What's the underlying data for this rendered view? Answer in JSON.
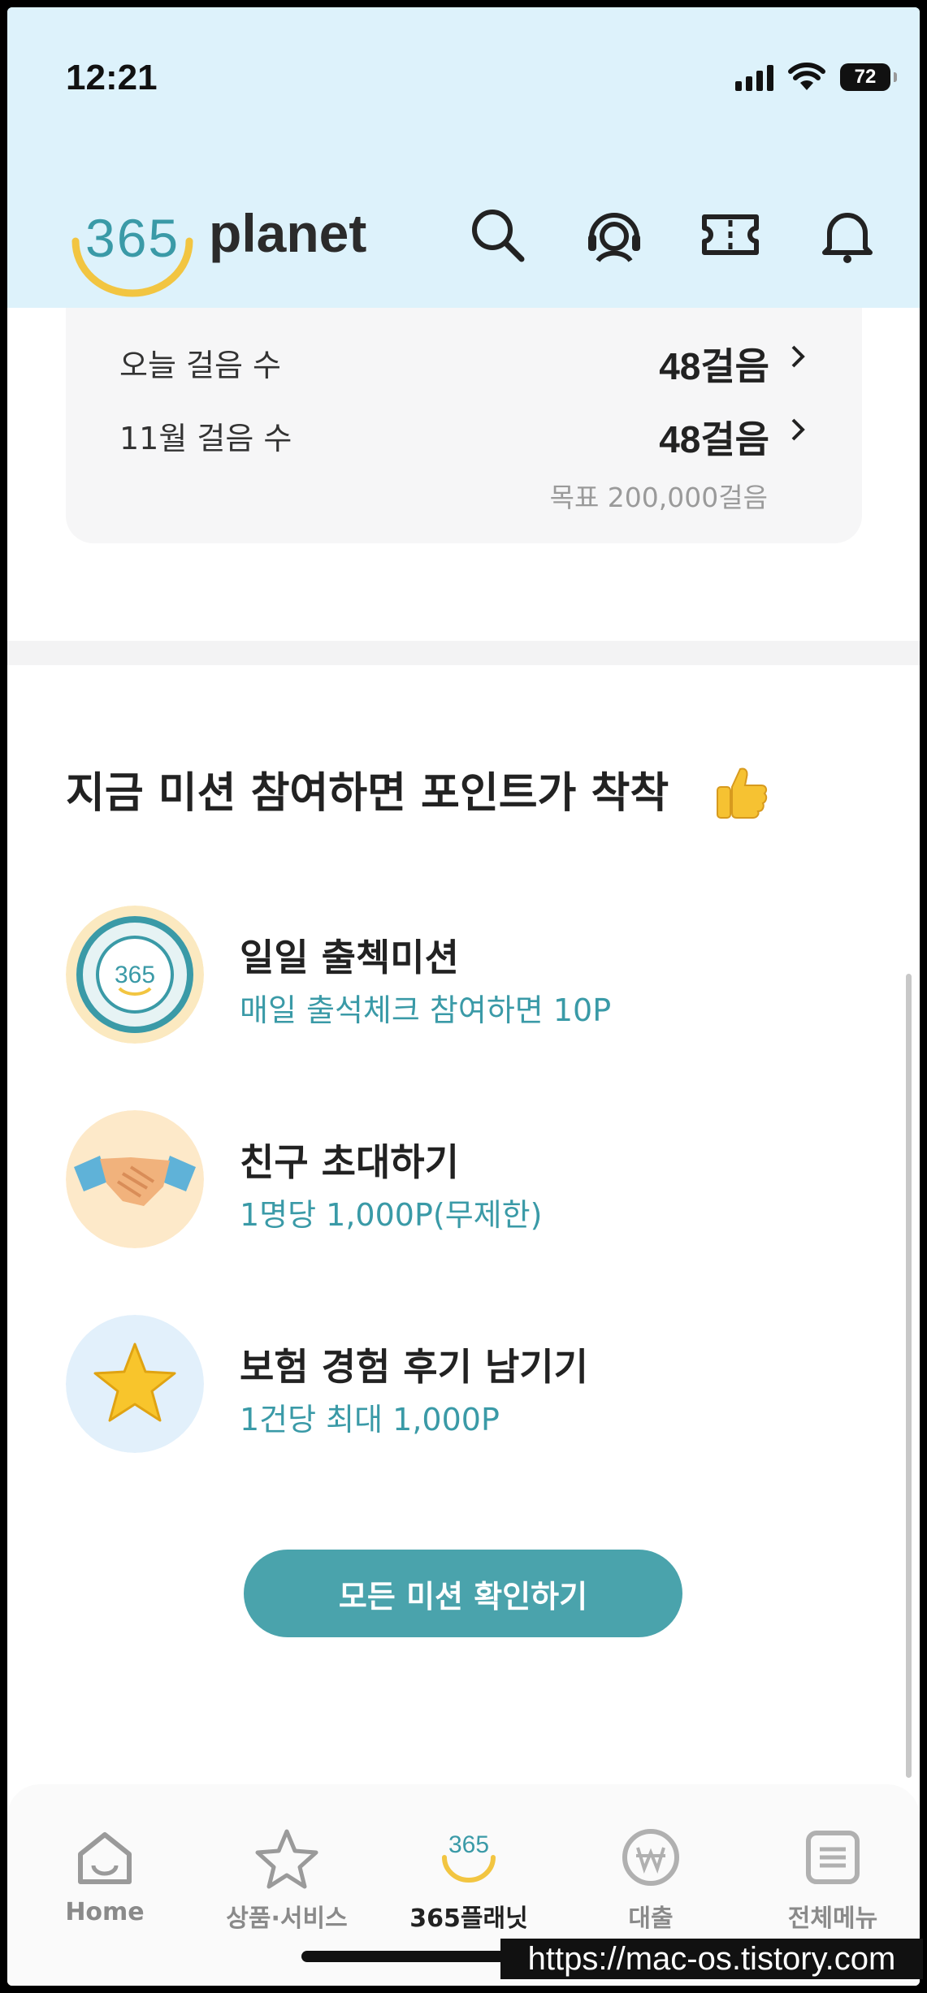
{
  "status": {
    "time": "12:21",
    "battery": "72"
  },
  "header": {
    "logo_number": "365",
    "logo_text": "planet",
    "icons": [
      "search-icon",
      "headset-icon",
      "ticket-icon",
      "bell-icon"
    ]
  },
  "steps": {
    "rows": [
      {
        "label": "오늘 걸음 수",
        "value": "48걸음"
      },
      {
        "label": "11월 걸음 수",
        "value": "48걸음"
      }
    ],
    "goal": "목표 200,000걸음"
  },
  "missions": {
    "title": "지금 미션 참여하면 포인트가 착착",
    "items": [
      {
        "name": "일일 출첵미션",
        "desc": "매일 출석체크 참여하면 10P",
        "icon": "attendance-stamp-icon"
      },
      {
        "name": "친구 초대하기",
        "desc": "1명당 1,000P(무제한)",
        "icon": "handshake-icon"
      },
      {
        "name": "보험 경험 후기 남기기",
        "desc": "1건당 최대 1,000P",
        "icon": "star-icon"
      }
    ],
    "cta": "모든 미션 확인하기"
  },
  "tabbar": {
    "items": [
      {
        "label": "Home",
        "icon": "home-icon"
      },
      {
        "label": "상품·서비스",
        "icon": "star-outline-icon"
      },
      {
        "label": "365플래닛",
        "icon": "planet-365-icon",
        "icon_text": "365"
      },
      {
        "label": "대출",
        "icon": "won-icon"
      },
      {
        "label": "전체메뉴",
        "icon": "menu-icon"
      }
    ],
    "active": "365플래닛"
  },
  "watermark": "https://mac-os.tistory.com",
  "colors": {
    "accent": "#4aa3ac",
    "header_bg": "#ddf2fb",
    "logo_yellow": "#f2c541"
  }
}
